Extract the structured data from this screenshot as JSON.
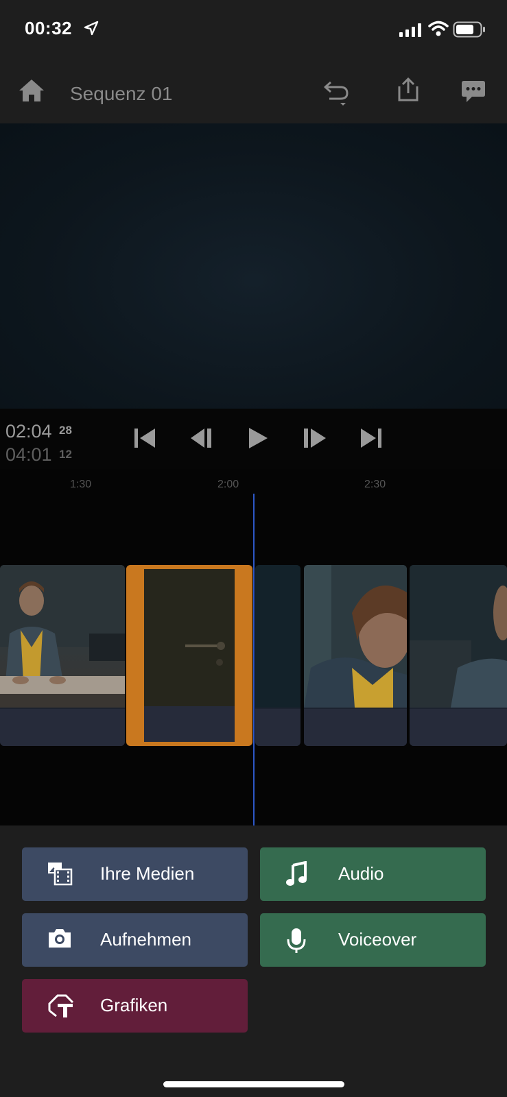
{
  "status": {
    "time": "00:32"
  },
  "header": {
    "title": "Sequenz 01"
  },
  "transport": {
    "current": "02:04",
    "current_frames": "28",
    "total": "04:01",
    "total_frames": "12"
  },
  "ruler": {
    "ticks": [
      "1:30",
      "2:00",
      "2:30"
    ]
  },
  "panel": {
    "media": "Ihre Medien",
    "audio": "Audio",
    "capture": "Aufnehmen",
    "voiceover": "Voiceover",
    "graphics": "Grafiken"
  },
  "colors": {
    "accent_selection": "#c9781f",
    "playhead": "#2d58c8",
    "media_buttons": "#3d4a63",
    "audio_buttons": "#356b4f",
    "graphics_button": "#621e3a"
  }
}
